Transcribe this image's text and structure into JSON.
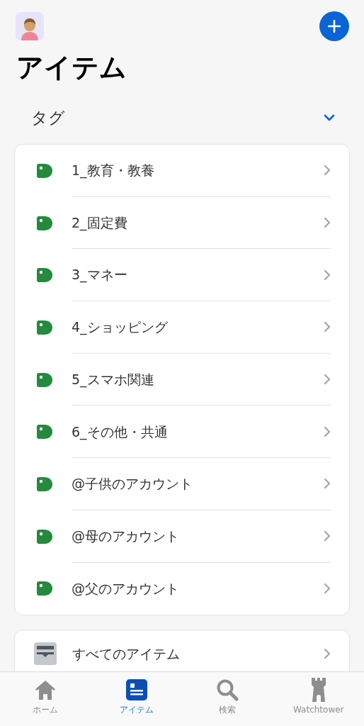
{
  "title": "アイテム",
  "tags_section": {
    "label": "タグ",
    "expanded": true
  },
  "tags": [
    {
      "label": "1_教育・教養"
    },
    {
      "label": "2_固定費"
    },
    {
      "label": "3_マネー"
    },
    {
      "label": "4_ショッピング"
    },
    {
      "label": "5_スマホ関連"
    },
    {
      "label": "6_その他・共通"
    },
    {
      "label": "@子供のアカウント"
    },
    {
      "label": "@母のアカウント"
    },
    {
      "label": "@父のアカウント"
    }
  ],
  "all_items": {
    "label": "すべてのアイテム"
  },
  "tab_bar": [
    {
      "kind": "home",
      "label": "ホーム",
      "selected": false
    },
    {
      "kind": "items",
      "label": "アイテム",
      "selected": true
    },
    {
      "kind": "search",
      "label": "検索",
      "selected": false
    },
    {
      "kind": "tower",
      "label": "Watchtower",
      "selected": false
    }
  ]
}
